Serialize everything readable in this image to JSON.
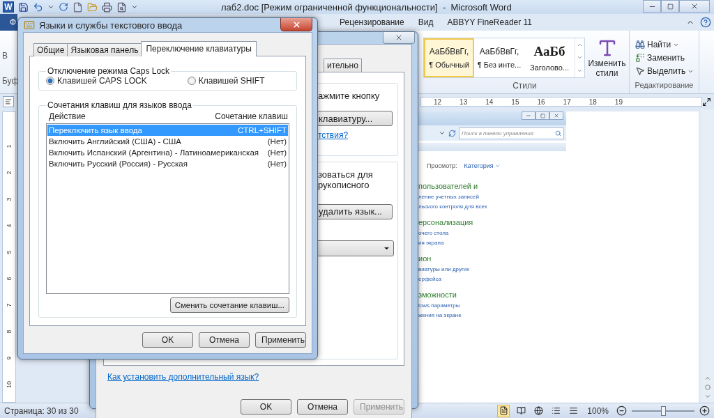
{
  "word": {
    "app_logo": "W",
    "title": "лаб2.doc [Режим ограниченной функциональности]  -  Microsoft Word",
    "file_tab": "Ф",
    "ribbon_tabs": [
      {
        "label": "Рецензирование",
        "selected": false
      },
      {
        "label": "Вид",
        "selected": false
      },
      {
        "label": "ABBYY FineReader 11",
        "selected": false
      }
    ],
    "ribbon_left": [
      "В",
      "Буф"
    ],
    "styles": [
      {
        "sample": "АаБбВвГг,",
        "name": "¶ Обычный",
        "selected": true,
        "kind": "normal"
      },
      {
        "sample": "АаБбВвГг,",
        "name": "¶ Без инте...",
        "selected": false,
        "kind": "normal"
      },
      {
        "sample": "АаБб",
        "name": "Заголово...",
        "selected": false,
        "kind": "heading"
      }
    ],
    "change_styles": "Изменить стили",
    "styles_label": "Стили",
    "editing": [
      {
        "label": "Найти",
        "kind": "find",
        "dropdown": true
      },
      {
        "label": "Заменить",
        "kind": "replace",
        "dropdown": false
      },
      {
        "label": "Выделить",
        "kind": "select",
        "dropdown": true
      }
    ],
    "editing_label": "Редактирование",
    "ruler": [
      "12",
      "13",
      "14",
      "15",
      "16",
      "17",
      "18",
      "19"
    ],
    "vruler": [
      "1",
      "2",
      "3",
      "4",
      "5",
      "6",
      "7",
      "8",
      "9",
      "10"
    ],
    "status": {
      "page": "Страница: 30 из 30",
      "zoom": "100%",
      "level": 0.5
    }
  },
  "control_panel": {
    "search_placeholder": "Поиск в панели управления",
    "view_label": "Просмотр:",
    "view_value": "Категория",
    "items": [
      {
        "kind": "heading",
        "text": "пользователей и"
      },
      {
        "kind": "link",
        "text": "ление учетных записей"
      },
      {
        "kind": "link",
        "text": "льского контроля для всех"
      },
      {
        "kind": "heading",
        "text": "ерсонализация"
      },
      {
        "kind": "link",
        "text": "очего стола"
      },
      {
        "kind": "link",
        "text": "ия экрана"
      },
      {
        "kind": "heading",
        "text": "ион"
      },
      {
        "kind": "link",
        "text": "виатуры или других"
      },
      {
        "kind": "link",
        "text": "ерфейса"
      },
      {
        "kind": "heading",
        "text": "зможности"
      },
      {
        "kind": "link",
        "text": "lows параметры"
      },
      {
        "kind": "link",
        "text": "жения на экране"
      }
    ]
  },
  "region_dialog": {
    "tab": "ительно",
    "text_1": "ажмите кнопку",
    "button_1": "клавиатуру...",
    "link_1": "тствия?",
    "text_2": [
      "зоваться для",
      "рукописного"
    ],
    "button_2": "удалить язык...",
    "link_2": "Как установить дополнительный язык?",
    "buttons": [
      {
        "label": "OK",
        "disabled": false
      },
      {
        "label": "Отмена",
        "disabled": false
      },
      {
        "label": "Применить",
        "disabled": true
      }
    ]
  },
  "dialog": {
    "title": "Языки и службы текстового ввода",
    "tabs": [
      {
        "label": "Общие",
        "selected": false
      },
      {
        "label": "Языковая панель",
        "selected": false
      },
      {
        "label": "Переключение клавиатуры",
        "selected": true
      }
    ],
    "caps_group": "Отключение режима Caps Lock",
    "caps_options": [
      {
        "label": "Клавишей CAPS LOCK",
        "selected": true
      },
      {
        "label": "Клавишей SHIFT",
        "selected": false
      }
    ],
    "hotkeys_group": "Сочетания клавиш для языков ввода",
    "columns": [
      "Действие",
      "Сочетание клавиш"
    ],
    "rows": [
      {
        "action": "Переключить язык ввода",
        "keys": "CTRL+SHIFT",
        "selected": true
      },
      {
        "action": "Включить Английский (США) - США",
        "keys": "(Нет)",
        "selected": false
      },
      {
        "action": "Включить Испанский (Аргентина) - Латиноамериканская",
        "keys": "(Нет)",
        "selected": false
      },
      {
        "action": "Включить Русский (Россия) - Русская",
        "keys": "(Нет)",
        "selected": false
      }
    ],
    "change_button": "Сменить сочетание клавиш...",
    "buttons": [
      "OK",
      "Отмена",
      "Применить"
    ]
  }
}
